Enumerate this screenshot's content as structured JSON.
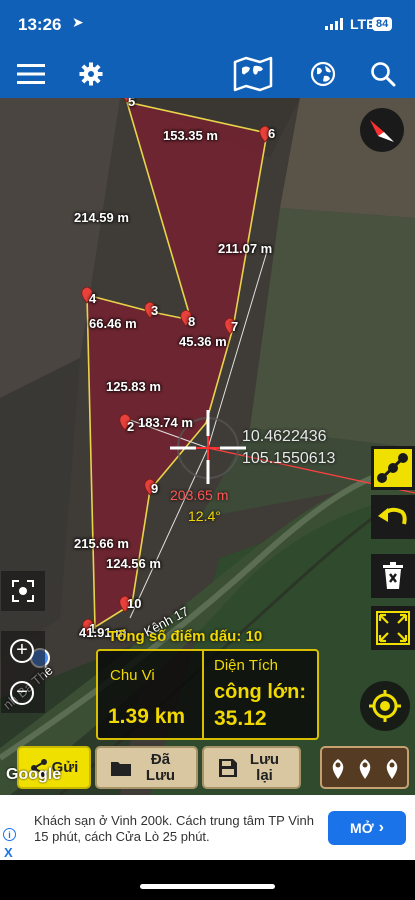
{
  "status_bar": {
    "time": "13:26",
    "location_icon": "location-arrow-icon",
    "network": "LTE",
    "battery": "84"
  },
  "header": {
    "icons": [
      "menu-icon",
      "gear-icon",
      "world-map-icon",
      "globe-icon",
      "search-icon"
    ]
  },
  "map": {
    "point_labels": [
      "5",
      "6",
      "4",
      "3",
      "8",
      "7",
      "2",
      "9",
      "10",
      "1"
    ],
    "segment_labels": [
      "153.35 m",
      "214.59 m",
      "211.07 m",
      "66.46 m",
      "45.36 m",
      "125.83 m",
      "183.74 m",
      "215.66 m",
      "124.56 m",
      "41.91 m"
    ],
    "crosshair": {
      "latitude": "10.4622436",
      "longitude": "105.1550613",
      "distance": "203.65 m",
      "bearing": "12.4°"
    },
    "road_labels": [
      "Kênh 17",
      "nh Ba Thê"
    ],
    "attribution": "Google"
  },
  "measurement": {
    "point_count_label": "Tổng số điểm dấu:",
    "point_count": "10",
    "perimeter_title": "Chu Vi",
    "perimeter_value": "1.39 km",
    "area_title": "Diện Tích",
    "area_unit": "công lớn:",
    "area_value": "35.12"
  },
  "actions": {
    "send": "Gửi",
    "saved": "Đã Lưu",
    "save": "Lưu lại"
  },
  "ad": {
    "text": "Khách sạn ở Vinh 200k. Cách trung tâm TP Vinh 15 phút, cách Cửa Lò 25 phút.",
    "button": "MỞ",
    "info": "i",
    "close": "X"
  },
  "colors": {
    "header": "#1160b8",
    "polygon_fill": "#7a2030",
    "polygon_stroke": "#e8d44a",
    "accent_yellow": "#f0e000",
    "marker_red": "#e8403a"
  }
}
